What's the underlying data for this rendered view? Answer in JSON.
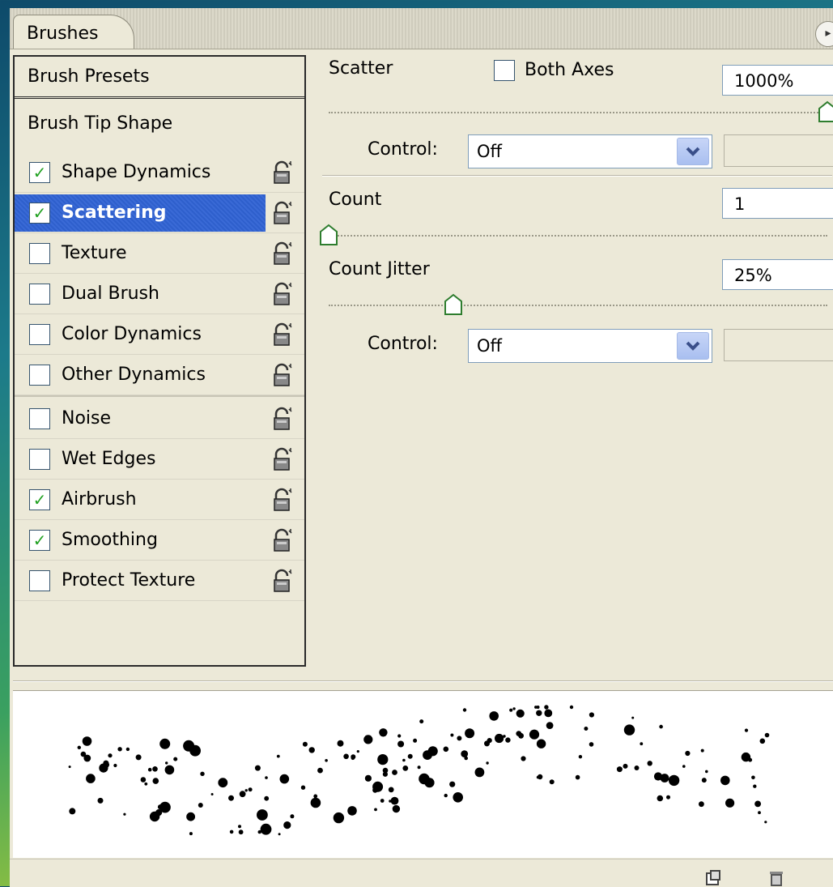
{
  "panel": {
    "tab_label": "Brushes"
  },
  "left_panel": {
    "preset_label": "Brush Presets",
    "tip_label": "Brush Tip Shape",
    "options": [
      {
        "label": "Shape Dynamics",
        "checked": true,
        "selected": false
      },
      {
        "label": "Scattering",
        "checked": true,
        "selected": true
      },
      {
        "label": "Texture",
        "checked": false,
        "selected": false
      },
      {
        "label": "Dual Brush",
        "checked": false,
        "selected": false
      },
      {
        "label": "Color Dynamics",
        "checked": false,
        "selected": false
      },
      {
        "label": "Other Dynamics",
        "checked": false,
        "selected": false
      }
    ],
    "extras": [
      {
        "label": "Noise",
        "checked": false
      },
      {
        "label": "Wet Edges",
        "checked": false
      },
      {
        "label": "Airbrush",
        "checked": true
      },
      {
        "label": "Smoothing",
        "checked": true
      },
      {
        "label": "Protect Texture",
        "checked": false
      }
    ],
    "lock_icon": "lock-icon"
  },
  "scattering": {
    "scatter_label": "Scatter",
    "both_axes_label": "Both Axes",
    "both_axes_checked": false,
    "scatter_value": "1000%",
    "scatter_level": 1.0,
    "control_label": "Control:",
    "scatter_control_value": "Off",
    "count_label": "Count",
    "count_value": "1",
    "count_level": 0.0,
    "count_jitter_label": "Count Jitter",
    "count_jitter_value": "25%",
    "count_jitter_level": 0.25,
    "jitter_control_value": "Off"
  },
  "colors": {
    "panel_bg": "#ece9d8",
    "selection": "#3166d4",
    "check": "#21a121"
  }
}
